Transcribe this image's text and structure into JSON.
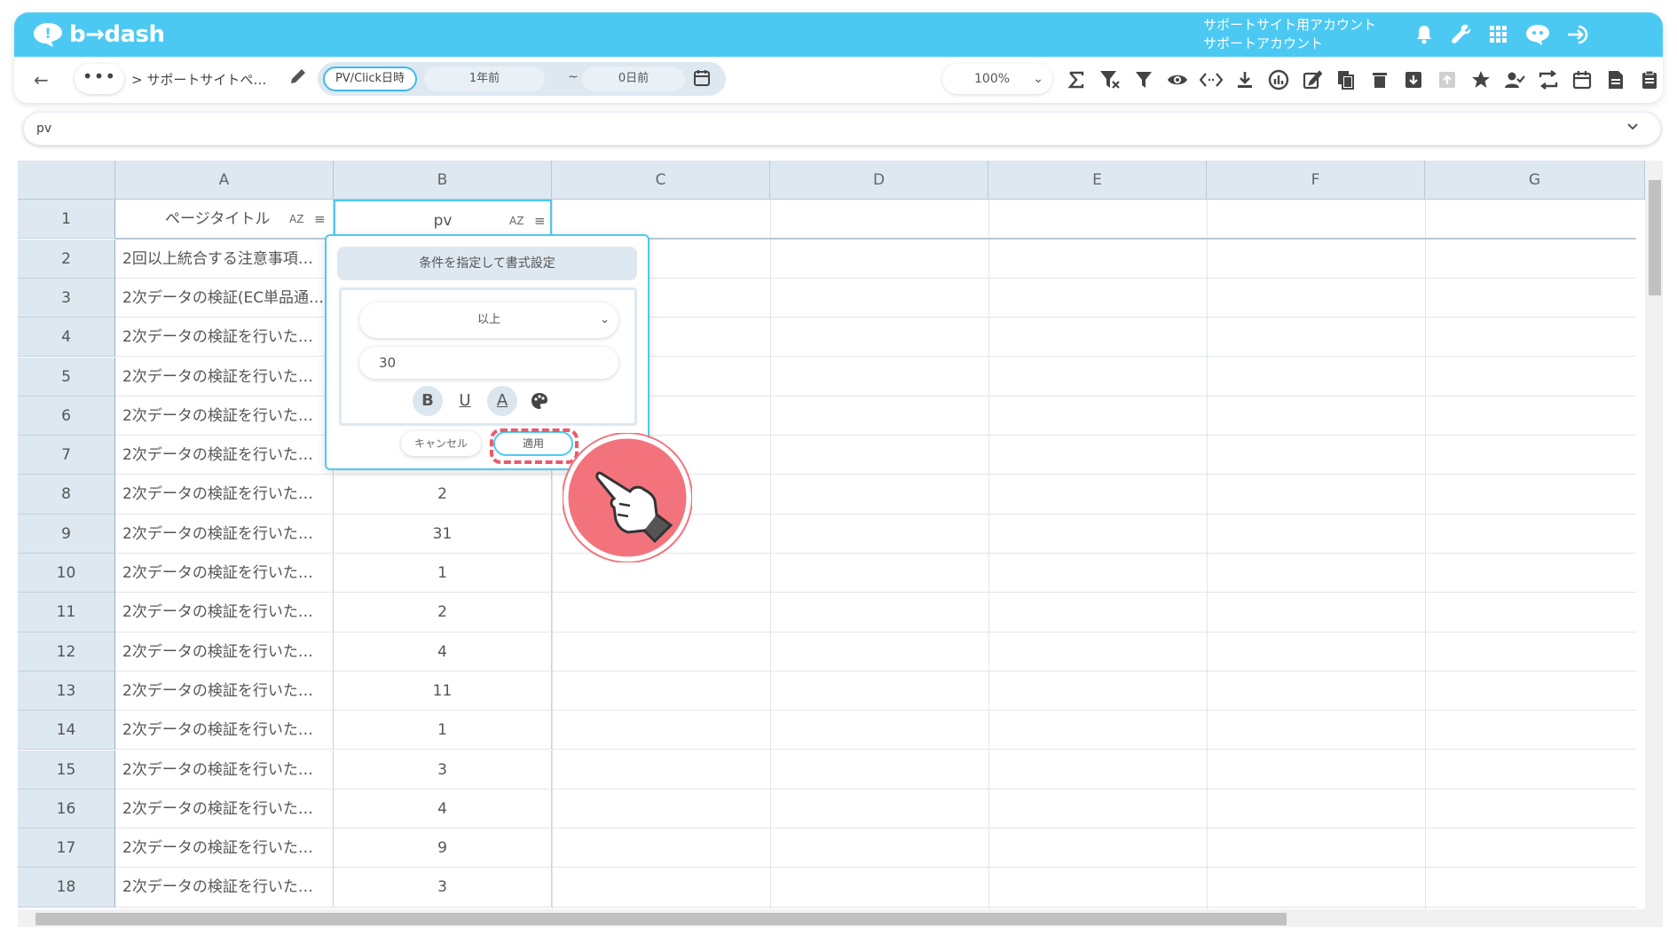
{
  "app": {
    "logo_text": "b→dash",
    "account_line1": "サポートサイト用アカウント",
    "account_line2": "サポートアカウント"
  },
  "toolbar": {
    "breadcrumb": "> サポートサイトペ…",
    "date_type": "PV/Click日時",
    "date_from": "1年前",
    "date_sep": "~",
    "date_to": "0日前",
    "zoom": "100%"
  },
  "sheet_selector": {
    "value": "pv"
  },
  "grid": {
    "columns": [
      "A",
      "B",
      "C",
      "D",
      "E",
      "F",
      "G"
    ],
    "header_row": {
      "num": "1",
      "a": "ページタイトル",
      "b": "pv"
    },
    "rows": [
      {
        "num": "2",
        "a": "2回以上統合する注意事項…",
        "b": ""
      },
      {
        "num": "3",
        "a": "2次データの検証(EC単品通…",
        "b": ""
      },
      {
        "num": "4",
        "a": "2次データの検証を行いた…",
        "b": ""
      },
      {
        "num": "5",
        "a": "2次データの検証を行いた…",
        "b": ""
      },
      {
        "num": "6",
        "a": "2次データの検証を行いた…",
        "b": ""
      },
      {
        "num": "7",
        "a": "2次データの検証を行いた…",
        "b": ""
      },
      {
        "num": "8",
        "a": "2次データの検証を行いた…",
        "b": "2"
      },
      {
        "num": "9",
        "a": "2次データの検証を行いた…",
        "b": "31"
      },
      {
        "num": "10",
        "a": "2次データの検証を行いた…",
        "b": "1"
      },
      {
        "num": "11",
        "a": "2次データの検証を行いた…",
        "b": "2"
      },
      {
        "num": "12",
        "a": "2次データの検証を行いた…",
        "b": "4"
      },
      {
        "num": "13",
        "a": "2次データの検証を行いた…",
        "b": "11"
      },
      {
        "num": "14",
        "a": "2次データの検証を行いた…",
        "b": "1"
      },
      {
        "num": "15",
        "a": "2次データの検証を行いた…",
        "b": "3"
      },
      {
        "num": "16",
        "a": "2次データの検証を行いた…",
        "b": "4"
      },
      {
        "num": "17",
        "a": "2次データの検証を行いた…",
        "b": "9"
      },
      {
        "num": "18",
        "a": "2次データの検証を行いた…",
        "b": "3"
      }
    ]
  },
  "popup": {
    "title": "条件を指定して書式設定",
    "condition": "以上",
    "value": "30",
    "cancel": "キャンセル",
    "apply": "適用"
  },
  "colors": {
    "accent": "#4cc9f3",
    "header_bg": "#dde8f1",
    "highlight": "#ea5a6a"
  }
}
